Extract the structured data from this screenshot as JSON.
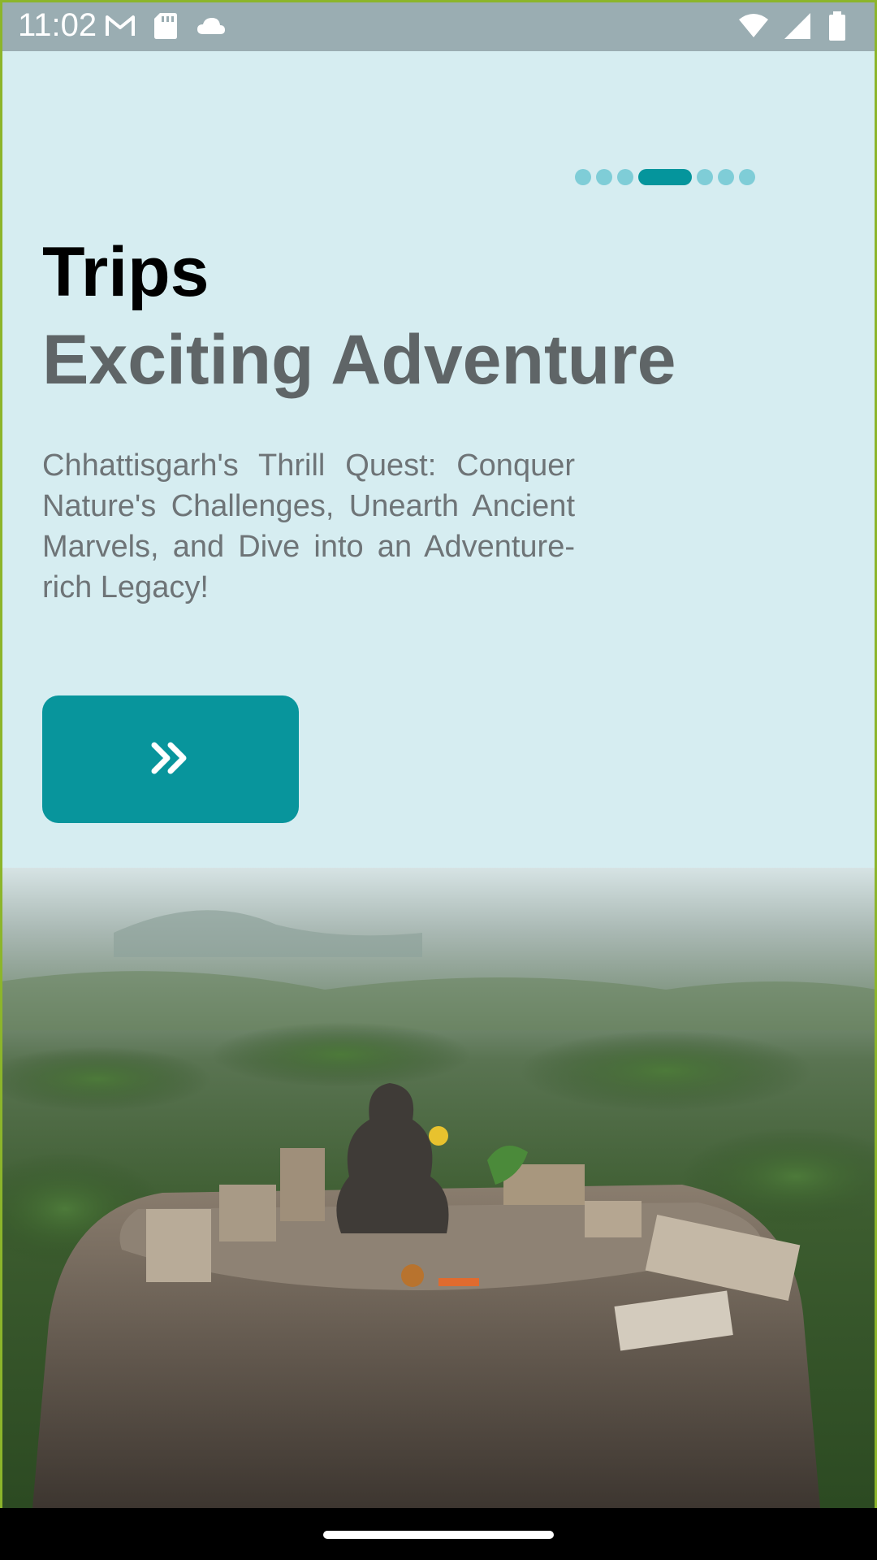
{
  "status_bar": {
    "time": "11:02",
    "left_icons": [
      "gmail-icon",
      "sd-card-icon",
      "cloud-icon"
    ],
    "right_icons": [
      "wifi-icon",
      "signal-icon",
      "battery-icon"
    ]
  },
  "pager": {
    "total": 7,
    "active_index": 3
  },
  "content": {
    "title": "Trips",
    "subtitle": "Exciting Adventure",
    "description": "Chhattisgarh's Thrill Quest: Conquer Nature's Challenges, Unearth Ancient Marvels, and Dive into an Adventure-rich Legacy!"
  },
  "next_button": {
    "icon": "double-chevron-right-icon"
  },
  "colors": {
    "background": "#d6edf1",
    "accent": "#08959c",
    "dot_inactive": "#7fcdd7",
    "status_bar": "#9aadb2"
  }
}
